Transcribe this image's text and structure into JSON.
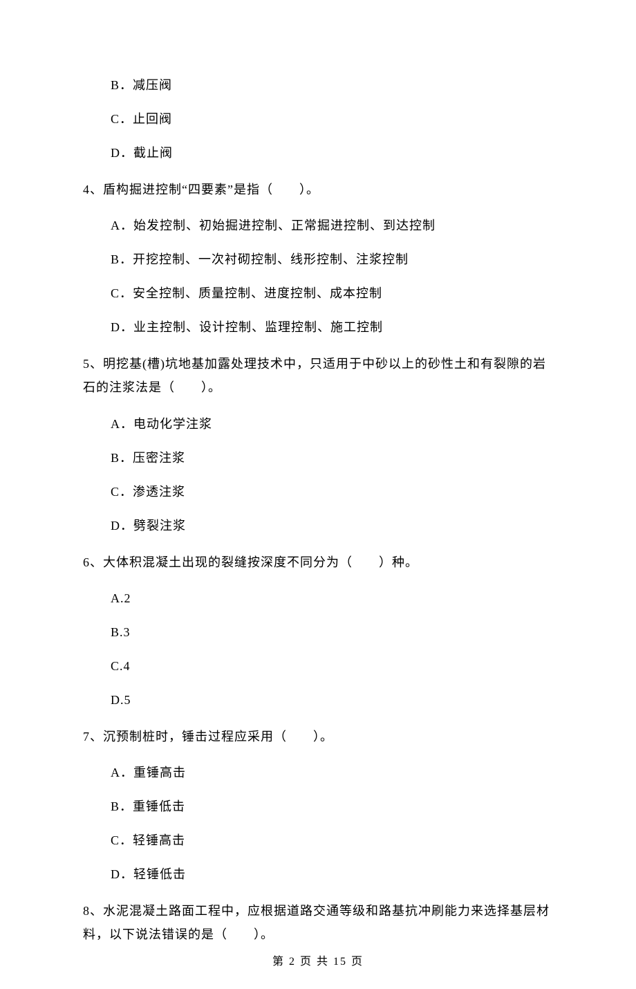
{
  "q3": {
    "optB": "B．减压阀",
    "optC": "C．止回阀",
    "optD": "D．截止阀"
  },
  "q4": {
    "stem": "4、盾构掘进控制“四要素”是指（　　）。",
    "optA": "A．始发控制、初始掘进控制、正常掘进控制、到达控制",
    "optB": "B．开挖控制、一次衬砌控制、线形控制、注浆控制",
    "optC": "C．安全控制、质量控制、进度控制、成本控制",
    "optD": "D．业主控制、设计控制、监理控制、施工控制"
  },
  "q5": {
    "stem": "5、明挖基(槽)坑地基加露处理技术中，只适用于中砂以上的砂性土和有裂隙的岩石的注浆法是（　　）。",
    "optA": "A．电动化学注浆",
    "optB": "B．压密注浆",
    "optC": "C．渗透注浆",
    "optD": "D．劈裂注浆"
  },
  "q6": {
    "stem": "6、大体积混凝土出现的裂缝按深度不同分为（　　）种。",
    "optA": "A.2",
    "optB": "B.3",
    "optC": "C.4",
    "optD": "D.5"
  },
  "q7": {
    "stem": "7、沉预制桩时，锤击过程应采用（　　）。",
    "optA": "A．重锤高击",
    "optB": "B．重锤低击",
    "optC": "C．轻锤高击",
    "optD": "D．轻锤低击"
  },
  "q8": {
    "stem": "8、水泥混凝土路面工程中，应根据道路交通等级和路基抗冲刷能力来选择基层材料，以下说法错误的是（　　）。"
  },
  "footer": "第 2 页 共 15 页"
}
